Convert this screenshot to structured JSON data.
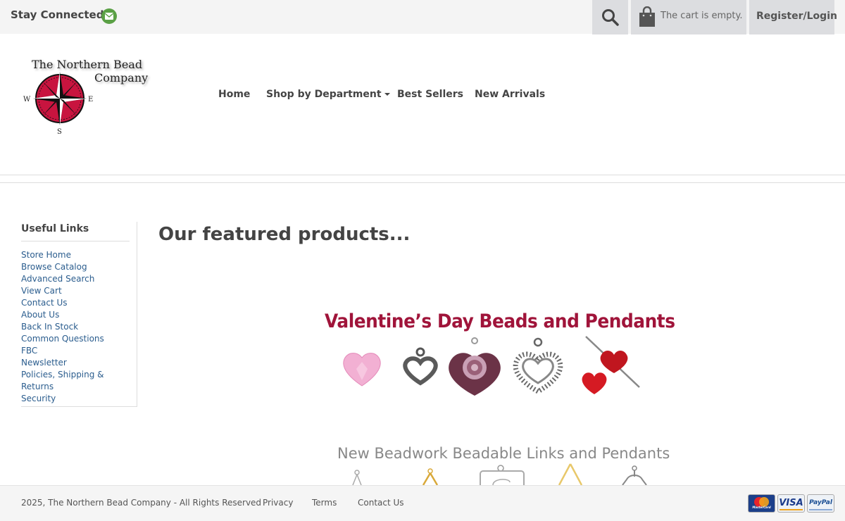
{
  "topbar": {
    "stay_connected": "Stay Connected:",
    "mail_icon": "email-icon",
    "search_icon": "search-icon",
    "cart_icon": "shopping-bag-icon",
    "cart_text": "The cart is empty.",
    "register_login": "Register/Login"
  },
  "logo": {
    "line1": "The Northern Bead",
    "line2": "Company",
    "compass_w": "W",
    "compass_e": "E",
    "compass_s": "S",
    "compass_color": "#c8143f"
  },
  "nav": {
    "items": [
      "Home",
      "Shop by Department",
      "Best Sellers",
      "New Arrivals"
    ]
  },
  "sidebar": {
    "title": "Useful Links",
    "links": [
      "Store Home",
      "Browse Catalog",
      "Advanced Search",
      "View Cart",
      "Contact Us",
      "About Us",
      "Back In Stock",
      "Common Questions",
      "FBC",
      "Newsletter",
      "Policies, Shipping & Returns",
      "Security"
    ]
  },
  "main": {
    "title": "Our featured products...",
    "banner1_title": "Valentine’s Day Beads and Pendants",
    "banner2_title": "New Beadwork Beadable Links and Pendants"
  },
  "footer": {
    "copyright": "2025, The Northern Bead Company - All Rights Reserved",
    "links": [
      "Privacy",
      "Terms",
      "Contact Us"
    ],
    "payments": [
      "MasterCard",
      "VISA",
      "PayPal"
    ]
  },
  "colors": {
    "accent_green": "#5aa045",
    "link_blue": "#2b5d8e",
    "banner_red": "#a0143a"
  }
}
